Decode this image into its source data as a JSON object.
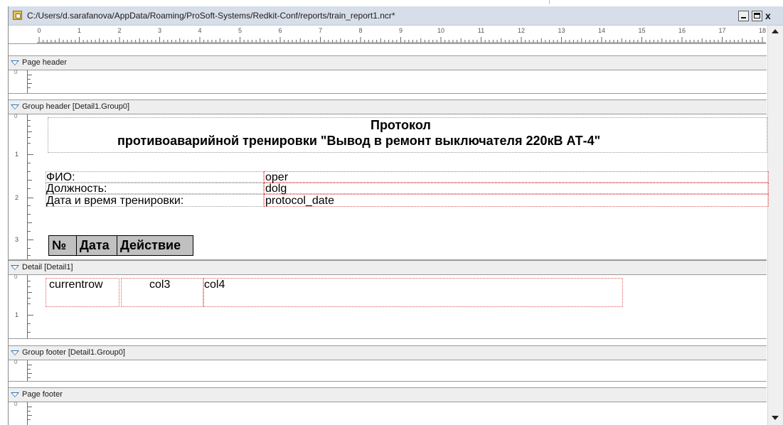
{
  "window": {
    "title": "C:/Users/d.sarafanova/AppData/Roaming/ProSoft-Systems/Redkit-Conf/reports/train_report1.ncr*",
    "icon": "report-file-icon",
    "close_glyph": "x"
  },
  "ruler": {
    "numbers": [
      "0",
      "1",
      "2",
      "3",
      "4",
      "5",
      "6",
      "7",
      "8",
      "9",
      "10",
      "11",
      "12",
      "13",
      "14",
      "15",
      "16",
      "17",
      "18"
    ]
  },
  "bands": {
    "page_header": {
      "label": "Page header",
      "ruler": [
        "0"
      ]
    },
    "group_header": {
      "label": "Group header [Detail1.Group0]",
      "ruler": [
        "0",
        "1",
        "2",
        "3"
      ]
    },
    "detail": {
      "label": "Detail [Detail1]",
      "ruler": [
        "0",
        "1"
      ]
    },
    "group_footer": {
      "label": "Group footer [Detail1.Group0]",
      "ruler": [
        "0"
      ]
    },
    "page_footer": {
      "label": "Page footer",
      "ruler": [
        "0"
      ]
    }
  },
  "report": {
    "title_line1": "Протокол",
    "title_line2": "противоаварийной тренировки \"Вывод в ремонт выключателя 220кВ АТ-4\"",
    "fields": [
      {
        "label": "ФИО:",
        "value": "oper"
      },
      {
        "label": "Должность:",
        "value": "dolg"
      },
      {
        "label": "Дата и время тренировки:",
        "value": "protocol_date"
      }
    ],
    "columns": [
      "№",
      "Дата",
      "Действие"
    ],
    "detail_cells": [
      "currentrow",
      "col3",
      "col4"
    ]
  },
  "colors": {
    "titlebar": "#d7dee9",
    "band_header": "#eeeeee",
    "collapse_triangle": "#2e74b5",
    "field_border": "#e05a5a",
    "column_header_fill": "#c0c0c0"
  }
}
